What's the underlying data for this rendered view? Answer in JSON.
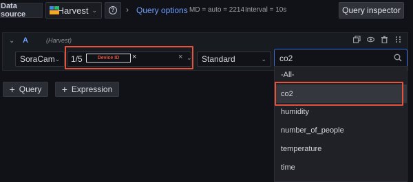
{
  "toolbar": {
    "data_source_label": "Data source",
    "data_source_name": "Harvest",
    "help_glyph": "?",
    "query_options_label": "Query options",
    "md_text": "MD = auto = 2214",
    "interval_text": "Interval = 10s",
    "query_inspector_label": "Query inspector"
  },
  "query_row": {
    "letter": "A",
    "datasource": "(Harvest)",
    "device_select": "SoraCam",
    "multi_count": "1/5",
    "chip_label": "Device ID",
    "aggregation": "Standard",
    "search_value": "co2",
    "icons": [
      "copy-icon",
      "eye-icon",
      "trash-icon",
      "drag-handle-icon"
    ]
  },
  "dropdown": {
    "options": [
      "-All-",
      "co2",
      "humidity",
      "number_of_people",
      "temperature",
      "time"
    ],
    "selected_index": 1
  },
  "actions": {
    "add_query_label": "Query",
    "add_expression_label": "Expression"
  },
  "colors": {
    "accent": "#6e9fff",
    "highlight_box": "#e5533d",
    "focus_border": "#3d71d9",
    "background": "#111217"
  }
}
